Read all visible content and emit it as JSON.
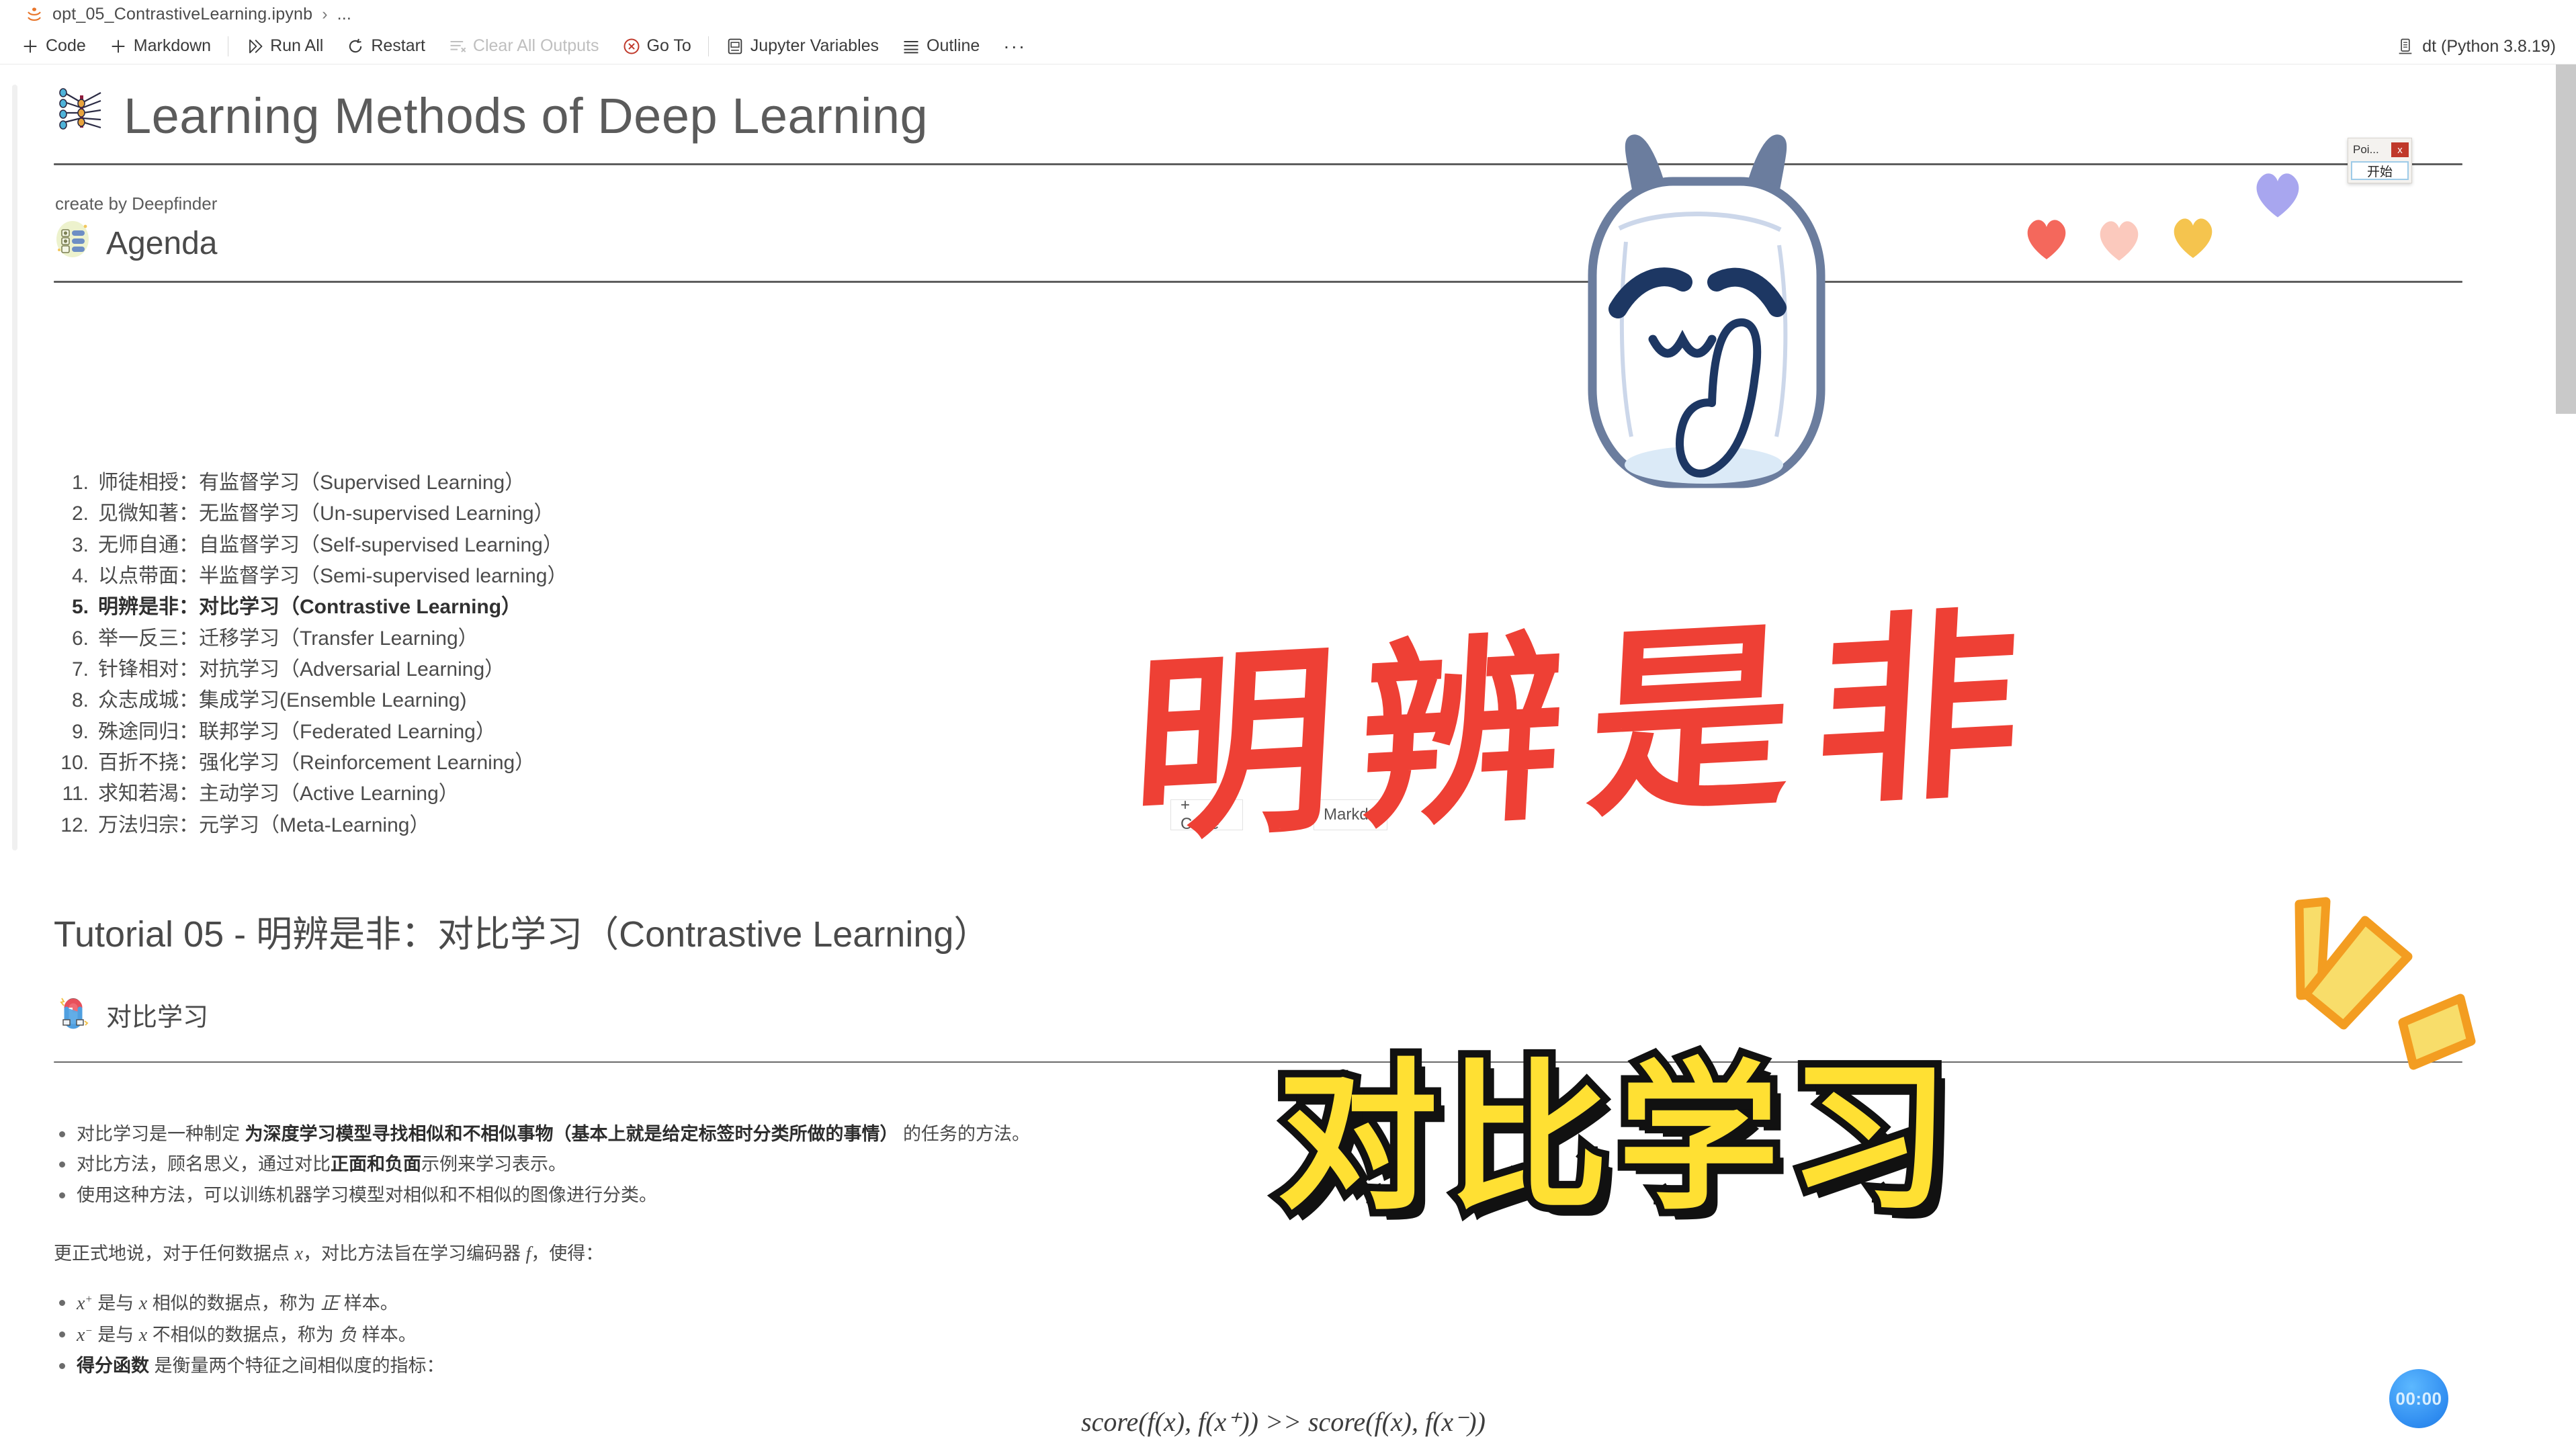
{
  "breadcrumb": {
    "icon": "jupyter-notebook-icon",
    "file": "opt_05_ContrastiveLearning.ipynb",
    "separator": "›",
    "more": "..."
  },
  "toolbar": {
    "items": [
      {
        "label": "Code",
        "icon": "plus-icon",
        "dim": false
      },
      {
        "label": "Markdown",
        "icon": "plus-icon",
        "dim": false
      },
      {
        "label": "Run All",
        "icon": "run-all-icon",
        "dim": false
      },
      {
        "label": "Restart",
        "icon": "restart-icon",
        "dim": false
      },
      {
        "label": "Clear All Outputs",
        "icon": "clear-outputs-icon",
        "dim": true
      },
      {
        "label": "Go To",
        "icon": "go-to-icon",
        "dim": false
      },
      {
        "label": "Jupyter Variables",
        "icon": "variables-icon",
        "dim": false
      },
      {
        "label": "Outline",
        "icon": "outline-icon",
        "dim": false
      }
    ],
    "overflow": "···",
    "kernel": {
      "label": "dt (Python 3.8.19)",
      "icon": "kernel-server-icon"
    }
  },
  "notebook": {
    "title": "Learning Methods of Deep Learning",
    "title_icon": "neural-network-icon",
    "byline": "create by Deepfinder",
    "agenda_heading": "Agenda",
    "agenda_icon": "agenda-list-icon",
    "agenda": [
      {
        "num": "1.",
        "text": "师徒相授：有监督学习（Supervised Learning）",
        "bold": false
      },
      {
        "num": "2.",
        "text": "见微知著：无监督学习（Un-supervised Learning）",
        "bold": false
      },
      {
        "num": "3.",
        "text": "无师自通：自监督学习（Self-supervised Learning）",
        "bold": false
      },
      {
        "num": "4.",
        "text": "以点带面：半监督学习（Semi-supervised learning）",
        "bold": false
      },
      {
        "num": "5.",
        "text": "明辨是非：对比学习（Contrastive Learning）",
        "bold": true
      },
      {
        "num": "6.",
        "text": "举一反三：迁移学习（Transfer Learning）",
        "bold": false
      },
      {
        "num": "7.",
        "text": "针锋相对：对抗学习（Adversarial Learning）",
        "bold": false
      },
      {
        "num": "8.",
        "text": "众志成城：集成学习(Ensemble Learning)",
        "bold": false
      },
      {
        "num": "9.",
        "text": "殊途同归：联邦学习（Federated Learning）",
        "bold": false
      },
      {
        "num": "10.",
        "text": "百折不挠：强化学习（Reinforcement Learning）",
        "bold": false
      },
      {
        "num": "11.",
        "text": "求知若渴：主动学习（Active Learning）",
        "bold": false
      },
      {
        "num": "12.",
        "text": "万法归宗：元学习（Meta-Learning）",
        "bold": false
      }
    ],
    "tutorial_heading": "Tutorial 05 - 明辨是非：对比学习（Contrastive Learning）",
    "section_heading": "对比学习",
    "section_icon": "magnet-icon",
    "bullets": [
      {
        "pre": "对比学习是一种制定 ",
        "bold": "为深度学习模型寻找相似和不相似事物（基本上就是给定标签时分类所做的事情）",
        "post": " 的任务的方法。"
      },
      {
        "pre": "对比方法，顾名思义，通过对比",
        "bold": "正面和负面",
        "post": "示例来学习表示。"
      },
      {
        "pre": "使用这种方法，可以训练机器学习模型对相似和不相似的图像进行分类。",
        "bold": "",
        "post": ""
      }
    ],
    "paragraph_parts": {
      "a": "更正式地说，对于任何数据点 ",
      "x": "x",
      "b": "，对比方法旨在学习编码器 ",
      "f": "f",
      "c": "，使得："
    },
    "sample_bullets": [
      {
        "sym": "x",
        "sign": "+",
        "mid": " 是与 ",
        "x2": "x",
        "post": " 相似的数据点，称为 ",
        "em": "正",
        "tail": " 样本。",
        "boldlead": ""
      },
      {
        "sym": "x",
        "sign": "−",
        "mid": " 是与 ",
        "x2": "x",
        "post": " 不相似的数据点，称为 ",
        "em": "负",
        "tail": " 样本。",
        "boldlead": ""
      },
      {
        "sym": "",
        "sign": "",
        "mid": "",
        "x2": "",
        "post": "",
        "em": "",
        "tail": " 是衡量两个特征之间相似度的指标：",
        "boldlead": "得分函数"
      }
    ],
    "formula": "score(f(x), f(x⁺)) >> score(f(x), f(x⁻))"
  },
  "ghost_toolbar": {
    "code": "+ Code",
    "markdown": "Markdo"
  },
  "overlays": {
    "calligraphy_red": "明辨是非",
    "calligraphy_yellow": "对比学习",
    "timer": "00:00",
    "mascot": "bilibili-mascot-icon",
    "hearts": [
      "#f4685c",
      "#fbc9bd",
      "#f5c44e",
      "#a8a6ef"
    ],
    "burst_color": "#f5d14b",
    "burst_stroke": "#f39d21"
  },
  "floating_widget": {
    "title": "Poi...",
    "close": "x",
    "start": "开始"
  },
  "colors": {
    "red": "#ee4035",
    "yellow": "#ffe033",
    "accent_blue": "#2f8cf0",
    "text": "#4a4a4a"
  }
}
